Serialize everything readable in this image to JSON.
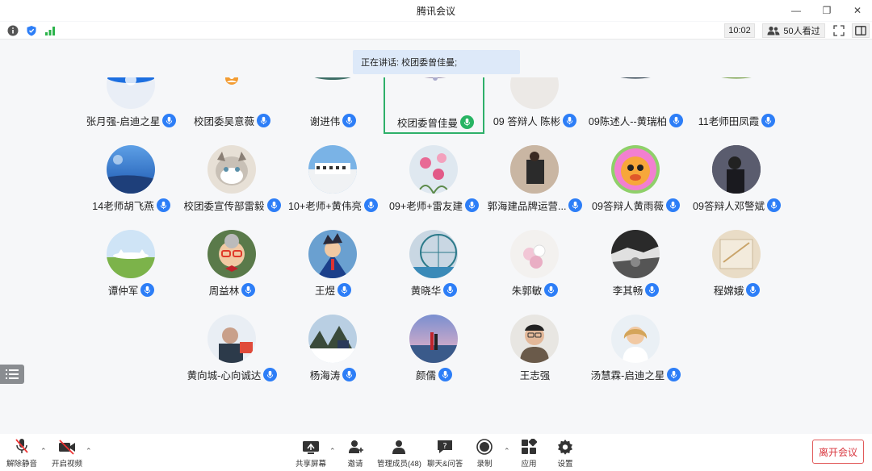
{
  "window": {
    "title": "腾讯会议"
  },
  "toolbar": {
    "time": "10:02",
    "viewers": "50人看过"
  },
  "speaking": "正在讲话: 校团委曾佳曼;",
  "participants": [
    {
      "name": "张月强-启迪之星",
      "mic": "blue",
      "avatar": "a0"
    },
    {
      "name": "校团委吴意薇",
      "mic": "blue",
      "avatar": "a1"
    },
    {
      "name": "谢进伟",
      "mic": "blue",
      "avatar": "a2"
    },
    {
      "name": "校团委曾佳曼",
      "mic": "green",
      "avatar": "a3"
    },
    {
      "name": "09  答辩人  陈彬",
      "mic": "blue",
      "avatar": "a4"
    },
    {
      "name": "09陈述人--黄瑞柏",
      "mic": "blue",
      "avatar": "a5"
    },
    {
      "name": "11老师田凤霞",
      "mic": "blue",
      "avatar": "a6"
    },
    {
      "name": "14老师胡飞燕",
      "mic": "blue",
      "avatar": "a7"
    },
    {
      "name": "校团委宣传部雷毅",
      "mic": "blue",
      "avatar": "a8"
    },
    {
      "name": "10+老师+黄伟亮",
      "mic": "blue",
      "avatar": "a9"
    },
    {
      "name": "09+老师+雷友建",
      "mic": "blue",
      "avatar": "a10"
    },
    {
      "name": "郭海建品牌运营...",
      "mic": "blue",
      "avatar": "a11"
    },
    {
      "name": "09答辩人黄雨薇",
      "mic": "blue",
      "avatar": "a12"
    },
    {
      "name": "09答辩人邓警斌",
      "mic": "blue",
      "avatar": "a13"
    },
    {
      "name": "谭仲军",
      "mic": "blue",
      "avatar": "a14"
    },
    {
      "name": "周益林",
      "mic": "blue",
      "avatar": "a15"
    },
    {
      "name": "王煜",
      "mic": "blue",
      "avatar": "a16"
    },
    {
      "name": "黄晓华",
      "mic": "blue",
      "avatar": "a17"
    },
    {
      "name": "朱郭敏",
      "mic": "blue",
      "avatar": "a18"
    },
    {
      "name": "李其畅",
      "mic": "blue",
      "avatar": "a19"
    },
    {
      "name": "程嫦娥",
      "mic": "blue",
      "avatar": "a20"
    },
    {
      "name": "黄向城-心向诚达",
      "mic": "blue",
      "avatar": "a21"
    },
    {
      "name": "杨海涛",
      "mic": "blue",
      "avatar": "a22"
    },
    {
      "name": "颜儒",
      "mic": "blue",
      "avatar": "a23"
    },
    {
      "name": "王志强",
      "mic": "none",
      "avatar": "a24"
    },
    {
      "name": "汤慧霖-启迪之星",
      "mic": "blue",
      "avatar": "a25"
    }
  ],
  "bottom": {
    "unmute": "解除静音",
    "video": "开启视频",
    "share": "共享屏幕",
    "invite": "邀请",
    "members": "管理成员(48)",
    "chat": "聊天&问答",
    "record": "录制",
    "apps": "应用",
    "settings": "设置",
    "leave": "离开会议"
  },
  "colors": {
    "accent": "#2d7ef7",
    "speaking": "#28b463",
    "leave": "#d9363e"
  }
}
